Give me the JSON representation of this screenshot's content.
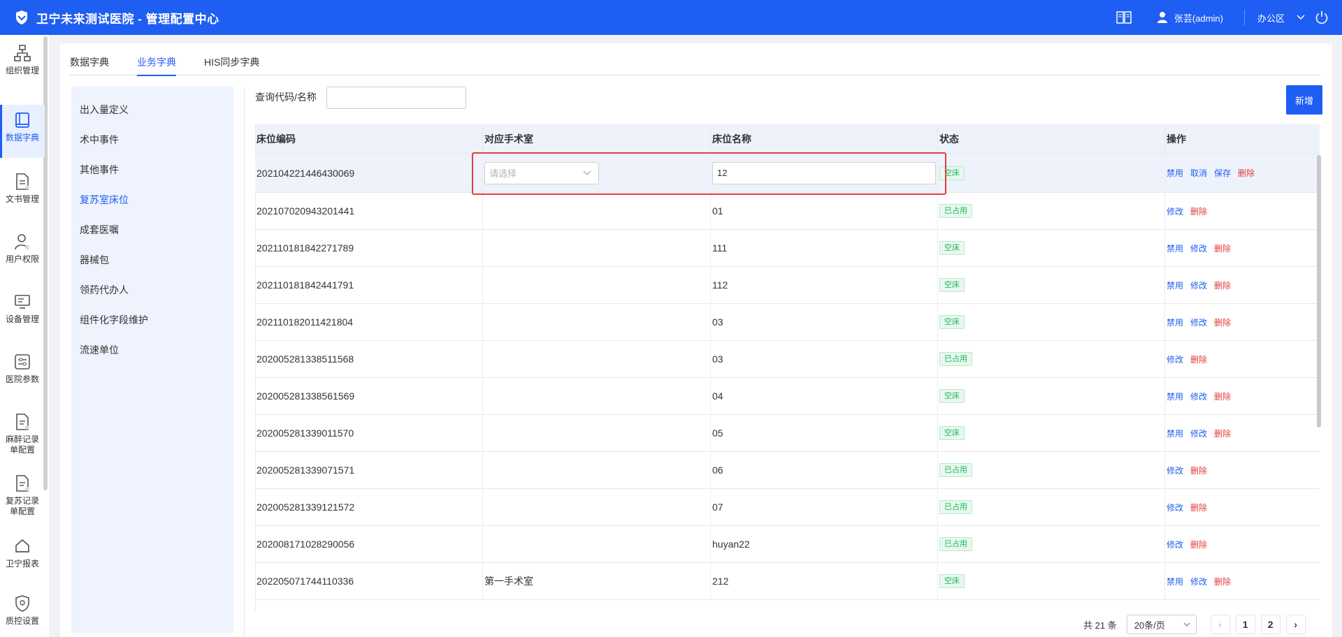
{
  "header": {
    "app_title": "卫宁未来测试医院 - 管理配置中心",
    "user": "张芸(admin)",
    "office": "办公区",
    "icons": [
      "shield-logo-icon",
      "book-icon",
      "user-icon",
      "chevron-down-icon",
      "power-icon"
    ],
    "brand_color": "#1f5ef2"
  },
  "leftnav": {
    "items": [
      {
        "label": "组织管理",
        "icon": "org-chart-icon",
        "active": false
      },
      {
        "label": "数据字典",
        "icon": "book-icon",
        "active": true
      },
      {
        "label": "文书管理",
        "icon": "document-icon",
        "active": false
      },
      {
        "label": "用户权限",
        "icon": "user-icon",
        "active": false
      },
      {
        "label": "设备管理",
        "icon": "monitor-icon",
        "active": false
      },
      {
        "label": "医院参数",
        "icon": "sliders-icon",
        "active": false
      },
      {
        "label": "麻醉记录单配置",
        "icon": "form-icon",
        "active": false
      },
      {
        "label": "复苏记录单配置",
        "icon": "form-icon",
        "active": false
      },
      {
        "label": "卫宁报表",
        "icon": "report-icon",
        "active": false
      },
      {
        "label": "质控设置",
        "icon": "shield-check-icon",
        "active": false
      }
    ]
  },
  "tabs": [
    {
      "label": "数据字典",
      "active": false
    },
    {
      "label": "业务字典",
      "active": true
    },
    {
      "label": "HIS同步字典",
      "active": false
    }
  ],
  "dict_list": [
    {
      "label": "出入量定义",
      "active": false
    },
    {
      "label": "术中事件",
      "active": false
    },
    {
      "label": "其他事件",
      "active": false
    },
    {
      "label": "复苏室床位",
      "active": true
    },
    {
      "label": "成套医嘱",
      "active": false
    },
    {
      "label": "器械包",
      "active": false
    },
    {
      "label": "领药代办人",
      "active": false
    },
    {
      "label": "组件化字段维护",
      "active": false
    },
    {
      "label": "流速单位",
      "active": false
    }
  ],
  "search": {
    "label": "查询代码/名称",
    "value": "",
    "placeholder": ""
  },
  "add_button": "新增",
  "table": {
    "columns": [
      "床位编码",
      "对应手术室",
      "床位名称",
      "状态",
      "操作"
    ],
    "editing_row": {
      "code": "202104221446430069",
      "room_placeholder": "请选择",
      "name": "12",
      "status": "空床",
      "ops": [
        {
          "label": "禁用",
          "danger": false
        },
        {
          "label": "取消",
          "danger": false
        },
        {
          "label": "保存",
          "danger": false
        },
        {
          "label": "删除",
          "danger": true
        }
      ]
    },
    "rows": [
      {
        "code": "202107020943201441",
        "room": "",
        "name": "01",
        "status": "已占用",
        "ops": [
          {
            "label": "修改",
            "danger": false
          },
          {
            "label": "删除",
            "danger": true
          }
        ]
      },
      {
        "code": "202110181842271789",
        "room": "",
        "name": "111",
        "status": "空床",
        "ops": [
          {
            "label": "禁用",
            "danger": false
          },
          {
            "label": "修改",
            "danger": false
          },
          {
            "label": "删除",
            "danger": true
          }
        ]
      },
      {
        "code": "202110181842441791",
        "room": "",
        "name": "112",
        "status": "空床",
        "ops": [
          {
            "label": "禁用",
            "danger": false
          },
          {
            "label": "修改",
            "danger": false
          },
          {
            "label": "删除",
            "danger": true
          }
        ]
      },
      {
        "code": "202110182011421804",
        "room": "",
        "name": "03",
        "status": "空床",
        "ops": [
          {
            "label": "禁用",
            "danger": false
          },
          {
            "label": "修改",
            "danger": false
          },
          {
            "label": "删除",
            "danger": true
          }
        ]
      },
      {
        "code": "202005281338511568",
        "room": "",
        "name": "03",
        "status": "已占用",
        "ops": [
          {
            "label": "修改",
            "danger": false
          },
          {
            "label": "删除",
            "danger": true
          }
        ]
      },
      {
        "code": "202005281338561569",
        "room": "",
        "name": "04",
        "status": "空床",
        "ops": [
          {
            "label": "禁用",
            "danger": false
          },
          {
            "label": "修改",
            "danger": false
          },
          {
            "label": "删除",
            "danger": true
          }
        ]
      },
      {
        "code": "202005281339011570",
        "room": "",
        "name": "05",
        "status": "空床",
        "ops": [
          {
            "label": "禁用",
            "danger": false
          },
          {
            "label": "修改",
            "danger": false
          },
          {
            "label": "删除",
            "danger": true
          }
        ]
      },
      {
        "code": "202005281339071571",
        "room": "",
        "name": "06",
        "status": "已占用",
        "ops": [
          {
            "label": "修改",
            "danger": false
          },
          {
            "label": "删除",
            "danger": true
          }
        ]
      },
      {
        "code": "202005281339121572",
        "room": "",
        "name": "07",
        "status": "已占用",
        "ops": [
          {
            "label": "修改",
            "danger": false
          },
          {
            "label": "删除",
            "danger": true
          }
        ]
      },
      {
        "code": "202008171028290056",
        "room": "",
        "name": "huyan22",
        "status": "已占用",
        "ops": [
          {
            "label": "修改",
            "danger": false
          },
          {
            "label": "删除",
            "danger": true
          }
        ]
      },
      {
        "code": "202205071744110336",
        "room": "第一手术室",
        "name": "212",
        "status": "空床",
        "ops": [
          {
            "label": "禁用",
            "danger": false
          },
          {
            "label": "修改",
            "danger": false
          },
          {
            "label": "删除",
            "danger": true
          }
        ]
      }
    ]
  },
  "pagination": {
    "total": "共 21 条",
    "page_size": "20条/页",
    "pages": [
      "1",
      "2"
    ],
    "prev": "‹",
    "next": "›"
  }
}
